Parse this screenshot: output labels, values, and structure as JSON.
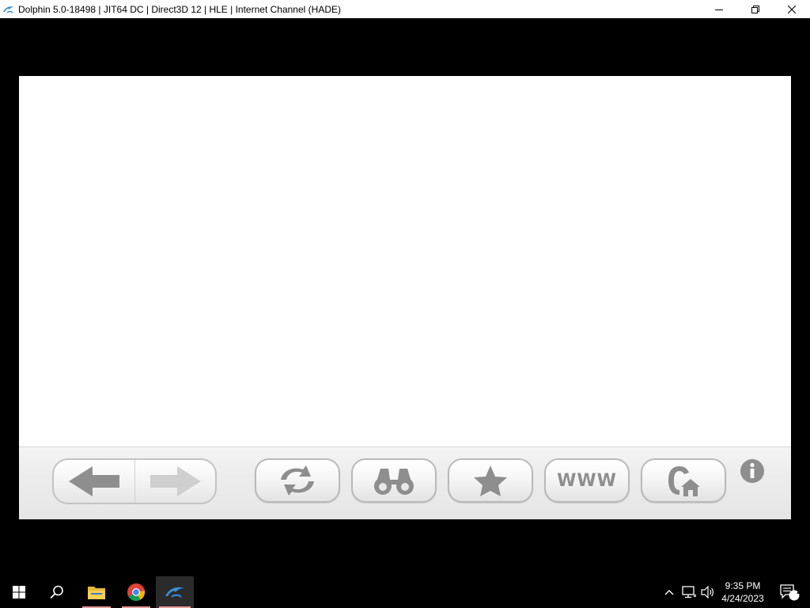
{
  "window": {
    "title": "Dolphin 5.0-18498 | JIT64 DC | Direct3D 12 | HLE | Internet Channel (HADE)"
  },
  "toolbar": {
    "www_label": "WWW",
    "nav_back_enabled": true,
    "nav_forward_enabled": false
  },
  "taskbar": {
    "time": "9:35 PM",
    "date": "4/24/2023",
    "notification_count": "2",
    "pinned": [
      "file-explorer-icon",
      "chrome-icon",
      "dolphin-icon"
    ]
  },
  "colors": {
    "accent_dolphin": "#3a8fd6",
    "wii_icon_gray": "#8e8e8e"
  }
}
